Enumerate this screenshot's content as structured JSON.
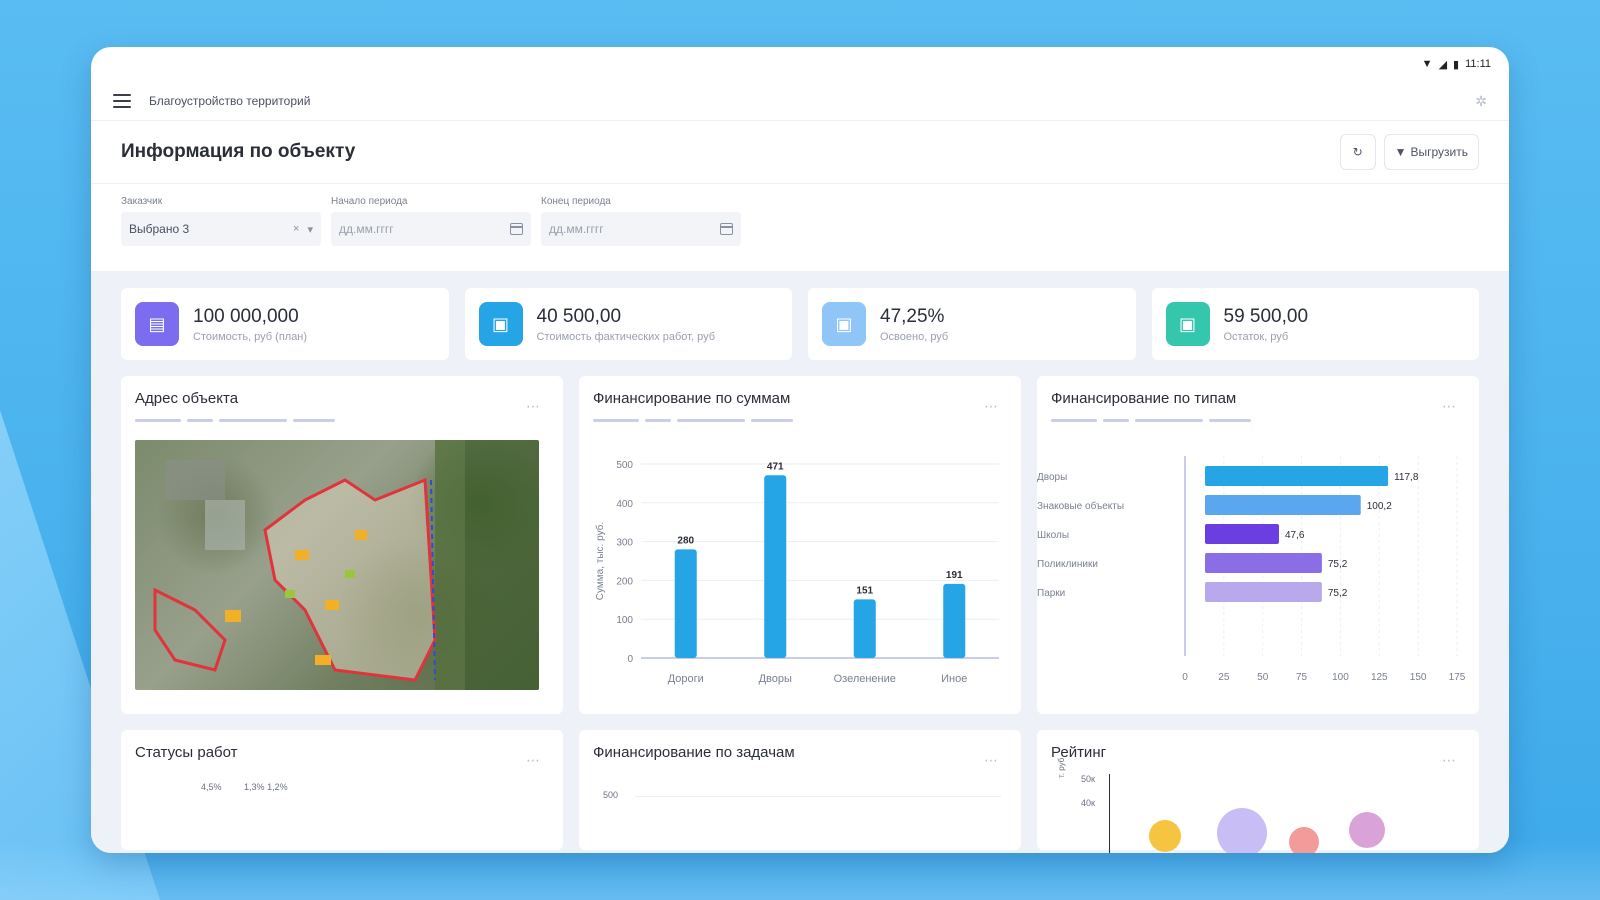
{
  "statusbar": {
    "time": "11:11"
  },
  "appbar": {
    "title": "Благоустройство территорий"
  },
  "page": {
    "title": "Информация по объекту"
  },
  "actions": {
    "refresh_icon": "refresh-icon",
    "export_label": "Выгрузить"
  },
  "filters": {
    "customer": {
      "label": "Заказчик",
      "value": "Выбрано 3"
    },
    "start": {
      "label": "Начало периода",
      "placeholder": "дд.мм.гггг"
    },
    "end": {
      "label": "Конец периода",
      "placeholder": "дд.мм.гггг"
    }
  },
  "kpis": [
    {
      "value": "100 000,000",
      "label": "Стоимость, руб (план)",
      "color": "#7b6cf0",
      "icon": "building-icon"
    },
    {
      "value": "40 500,00",
      "label": "Стоимость фактических работ, руб",
      "color": "#25a4e6",
      "icon": "wallet-icon"
    },
    {
      "value": "47,25%",
      "label": "Освоено, руб",
      "color": "#8fc6f7",
      "icon": "wallet-icon"
    },
    {
      "value": "59 500,00",
      "label": "Остаток, руб",
      "color": "#34c7ad",
      "icon": "wallet-icon"
    }
  ],
  "cards": {
    "address": {
      "title": "Адрес объекта"
    },
    "fin_sum": {
      "title": "Финансирование по суммам"
    },
    "fin_type": {
      "title": "Финансирование по типам"
    },
    "statuses": {
      "title": "Статусы работ",
      "peek_labels": [
        "4,5%",
        "1,3%",
        "1,2%"
      ]
    },
    "fin_tasks": {
      "title": "Финансирование по задачам",
      "peek_tick": "500"
    },
    "rating": {
      "title": "Рейтинг",
      "peek_ticks": [
        "50к",
        "40к"
      ],
      "peek_axis": "т. руб."
    }
  },
  "chart_data": [
    {
      "type": "bar",
      "categories": [
        "Дороги",
        "Дворы",
        "Озеленение",
        "Иное"
      ],
      "values": [
        280,
        471,
        151,
        191
      ],
      "data_labels": [
        "280",
        "471",
        "151",
        "191"
      ],
      "ylabel": "Сумма, тыс. руб.",
      "yticks": [
        0,
        100,
        200,
        300,
        400,
        500
      ],
      "ylim": [
        0,
        500
      ],
      "color": "#25a4e6"
    },
    {
      "type": "bar",
      "orientation": "horizontal",
      "categories": [
        "Дворы",
        "Знаковые объекты",
        "Школы",
        "Поликлиники",
        "Парки"
      ],
      "values": [
        117.8,
        100.2,
        47.6,
        75.2,
        75.2
      ],
      "data_labels": [
        "117,8",
        "100,2",
        "47,6",
        "75,2",
        "75,2"
      ],
      "xticks": [
        0,
        25,
        50,
        75,
        100,
        125,
        150,
        175
      ],
      "xlim": [
        0,
        175
      ],
      "colors": [
        "#25a4e6",
        "#5aa7f0",
        "#6a3ee0",
        "#8b6de6",
        "#b9a8ee"
      ]
    }
  ]
}
